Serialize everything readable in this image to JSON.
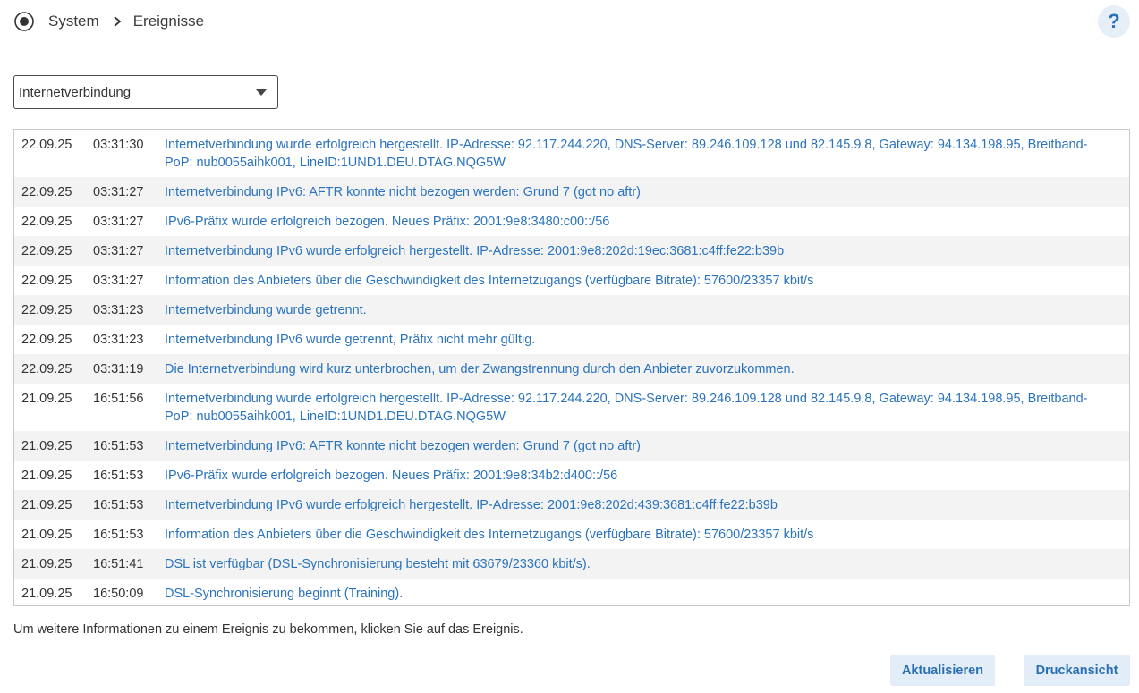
{
  "header": {
    "breadcrumb": [
      "System",
      "Ereignisse"
    ],
    "help_label": "?"
  },
  "filter": {
    "selected": "Internetverbindung"
  },
  "events": [
    {
      "date": "22.09.25",
      "time": "03:31:30",
      "message": "Internetverbindung wurde erfolgreich hergestellt. IP-Adresse: 92.117.244.220, DNS-Server: 89.246.109.128 und 82.145.9.8, Gateway: 94.134.198.95, Breitband-PoP: nub0055aihk001, LineID:1UND1.DEU.DTAG.NQG5W"
    },
    {
      "date": "22.09.25",
      "time": "03:31:27",
      "message": "Internetverbindung IPv6: AFTR konnte nicht bezogen werden: Grund 7 (got no aftr)"
    },
    {
      "date": "22.09.25",
      "time": "03:31:27",
      "message": "IPv6-Präfix wurde erfolgreich bezogen. Neues Präfix: 2001:9e8:3480:c00::/56"
    },
    {
      "date": "22.09.25",
      "time": "03:31:27",
      "message": "Internetverbindung IPv6 wurde erfolgreich hergestellt. IP-Adresse: 2001:9e8:202d:19ec:3681:c4ff:fe22:b39b"
    },
    {
      "date": "22.09.25",
      "time": "03:31:27",
      "message": "Information des Anbieters über die Geschwindigkeit des Internetzugangs (verfügbare Bitrate): 57600/23357 kbit/s"
    },
    {
      "date": "22.09.25",
      "time": "03:31:23",
      "message": "Internetverbindung wurde getrennt."
    },
    {
      "date": "22.09.25",
      "time": "03:31:23",
      "message": "Internetverbindung IPv6 wurde getrennt, Präfix nicht mehr gültig."
    },
    {
      "date": "22.09.25",
      "time": "03:31:19",
      "message": "Die Internetverbindung wird kurz unterbrochen, um der Zwangstrennung durch den Anbieter zuvorzukommen."
    },
    {
      "date": "21.09.25",
      "time": "16:51:56",
      "message": "Internetverbindung wurde erfolgreich hergestellt. IP-Adresse: 92.117.244.220, DNS-Server: 89.246.109.128 und 82.145.9.8, Gateway: 94.134.198.95, Breitband-PoP: nub0055aihk001, LineID:1UND1.DEU.DTAG.NQG5W"
    },
    {
      "date": "21.09.25",
      "time": "16:51:53",
      "message": "Internetverbindung IPv6: AFTR konnte nicht bezogen werden: Grund 7 (got no aftr)"
    },
    {
      "date": "21.09.25",
      "time": "16:51:53",
      "message": "IPv6-Präfix wurde erfolgreich bezogen. Neues Präfix: 2001:9e8:34b2:d400::/56"
    },
    {
      "date": "21.09.25",
      "time": "16:51:53",
      "message": "Internetverbindung IPv6 wurde erfolgreich hergestellt. IP-Adresse: 2001:9e8:202d:439:3681:c4ff:fe22:b39b"
    },
    {
      "date": "21.09.25",
      "time": "16:51:53",
      "message": "Information des Anbieters über die Geschwindigkeit des Internetzugangs (verfügbare Bitrate): 57600/23357 kbit/s"
    },
    {
      "date": "21.09.25",
      "time": "16:51:41",
      "message": "DSL ist verfügbar (DSL-Synchronisierung besteht mit 63679/23360 kbit/s)."
    },
    {
      "date": "21.09.25",
      "time": "16:50:09",
      "message": "DSL-Synchronisierung beginnt (Training)."
    }
  ],
  "footer": {
    "hint": "Um weitere Informationen zu einem Ereignis zu bekommen, klicken Sie auf das Ereignis.",
    "refresh_label": "Aktualisieren",
    "print_label": "Druckansicht"
  }
}
